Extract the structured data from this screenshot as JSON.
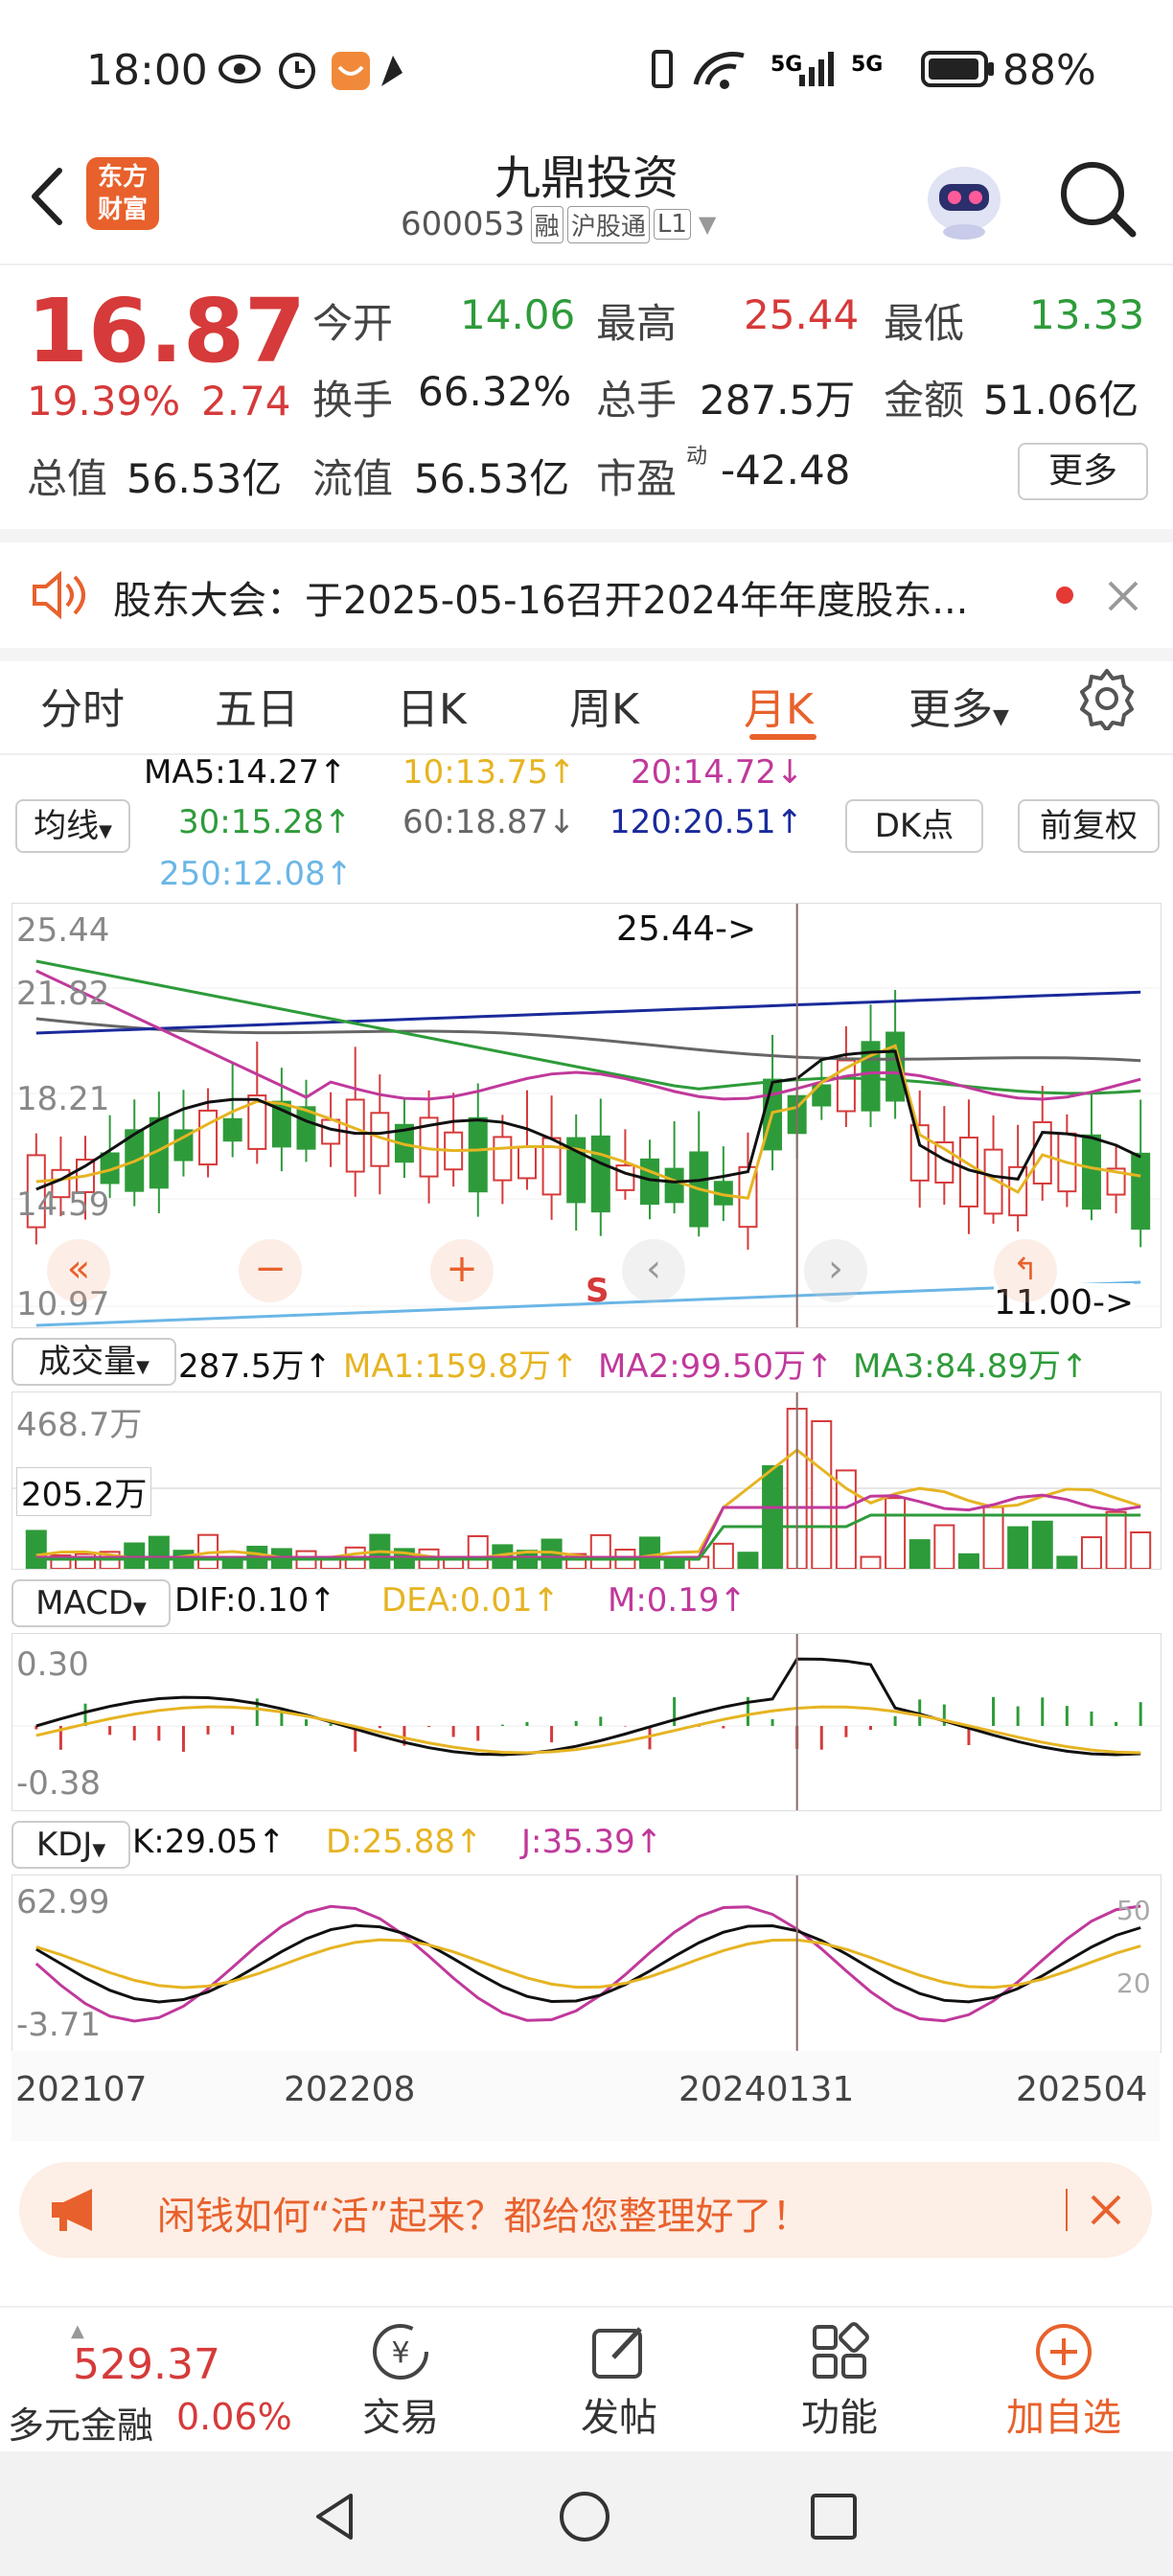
{
  "status": {
    "time": "18:00",
    "battery": "88%",
    "net1": "5G",
    "net2": "5G"
  },
  "header": {
    "logo_line1": "东方",
    "logo_line2": "财富",
    "stock_name": "九鼎投资",
    "code": "600053",
    "tag_rong": "融",
    "tag_hgt": "沪股通",
    "tag_level": "L1"
  },
  "quote": {
    "price": "16.87",
    "pct": "19.39%",
    "change": "2.74",
    "open_label": "今开",
    "open": "14.06",
    "high_label": "最高",
    "high": "25.44",
    "low_label": "最低",
    "low": "13.33",
    "turnover_label": "换手",
    "turnover": "66.32%",
    "volume_label": "总手",
    "volume": "287.5万",
    "amount_label": "金额",
    "amount": "51.06亿",
    "mktcap_label": "总值",
    "mktcap": "56.53亿",
    "float_label": "流值",
    "float": "56.53亿",
    "pe_label": "市盈",
    "pe_sup": "动",
    "pe": "-42.48",
    "more": "更多"
  },
  "notice": {
    "text": "股东大会：于2025-05-16召开2024年年度股东..."
  },
  "tabs": [
    "分时",
    "五日",
    "日K",
    "周K",
    "月K",
    "更多"
  ],
  "tab_active": 4,
  "ma": {
    "btn": "均线",
    "ma5": "MA5:14.27↑",
    "ma10": "10:13.75↑",
    "ma20": "20:14.72↓",
    "ma30": "30:15.28↑",
    "ma60": "60:18.87↓",
    "ma120": "120:20.51↑",
    "ma250": "250:12.08↑",
    "dk": "DK点",
    "fq": "前复权"
  },
  "kline": {
    "ymax": "25.44",
    "y2": "21.82",
    "y3": "18.21",
    "y4": "14.59",
    "ymin": "10.97",
    "high_note": "25.44->",
    "low_note": "11.00->",
    "sell_mark": "S"
  },
  "vol": {
    "btn": "成交量",
    "val": "287.5万↑",
    "ma1": "MA1:159.8万↑",
    "ma2": "MA2:99.50万↑",
    "ma3": "MA3:84.89万↑",
    "ymax": "468.7万",
    "ymid": "205.2万"
  },
  "macd": {
    "btn": "MACD",
    "dif": "DIF:0.10↑",
    "dea": "DEA:0.01↑",
    "m": "M:0.19↑",
    "ymax": "0.30",
    "ymin": "-0.38"
  },
  "kdj": {
    "btn": "KDJ",
    "k": "K:29.05↑",
    "d": "D:25.88↑",
    "j": "J:35.39↑",
    "ymax": "62.99",
    "ymin": "-3.71",
    "r50": "50",
    "r20": "20"
  },
  "dates": [
    "202107",
    "202208",
    "20240131",
    "202504"
  ],
  "ad": {
    "text": "闲钱如何“活”起来？都给您整理好了！"
  },
  "bottom": {
    "index_val": "529.37",
    "index_name": "多元金融",
    "index_pct": "0.06%",
    "trade": "交易",
    "post": "发帖",
    "func": "功能",
    "add": "加自选"
  },
  "colors": {
    "up": "#d63a3a",
    "down": "#2e9b3a",
    "accent": "#e8612c",
    "ma5": "#111111",
    "ma10": "#e6b422",
    "ma20": "#c0399b",
    "ma30": "#2e9b3a",
    "ma60": "#666666",
    "ma120": "#1a2a9b",
    "ma250": "#6bb6e6"
  }
}
